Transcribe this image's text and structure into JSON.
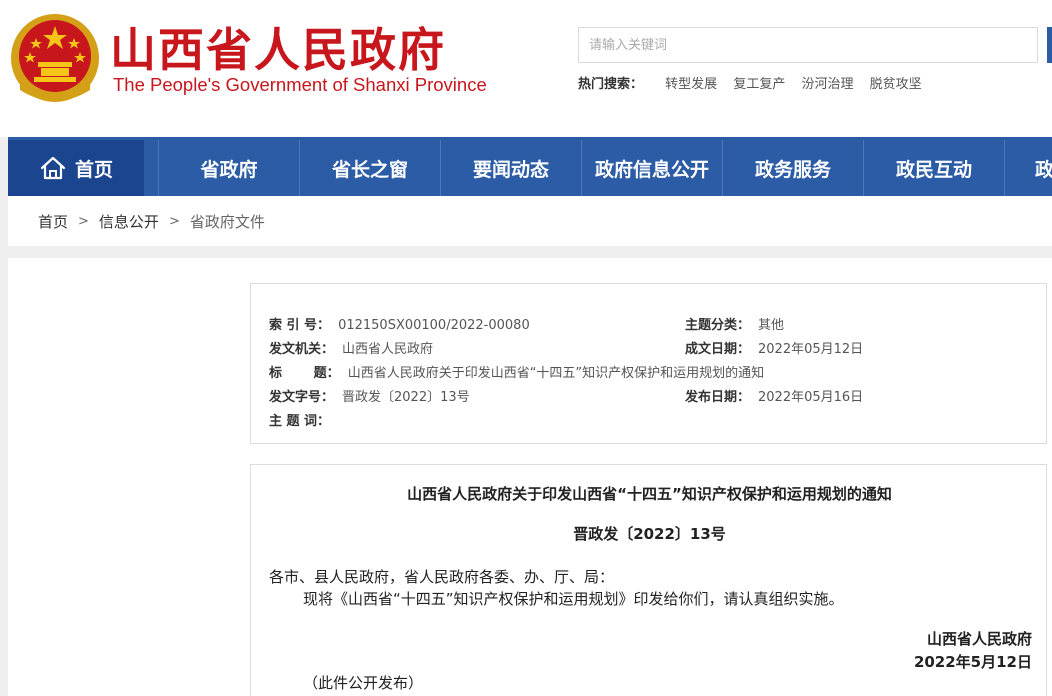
{
  "header": {
    "title": "山西省人民政府",
    "subtitle": "The People's Government of Shanxi Province",
    "search_placeholder": "请输入关键词",
    "hot_label": "热门搜索：",
    "hot_links": [
      "转型发展",
      "复工复产",
      "汾河治理",
      "脱贫攻坚"
    ]
  },
  "colors": {
    "brand_red": "#c8161d",
    "nav_blue": "#2b5ca5",
    "nav_active": "#1c4590"
  },
  "nav": {
    "home": "首页",
    "items": [
      "省政府",
      "省长之窗",
      "要闻动态",
      "政府信息公开",
      "政务服务",
      "政民互动",
      "政"
    ]
  },
  "breadcrumb": {
    "items": [
      "首页",
      "信息公开"
    ],
    "separator": ">",
    "current": "省政府文件"
  },
  "meta": {
    "index_key": "索  引 号：",
    "index_val": "012150SX00100/2022-00080",
    "category_key": "主题分类：",
    "category_val": "其他",
    "issuer_key": "发文机关：",
    "issuer_val": "山西省人民政府",
    "date_written_key": "成文日期：",
    "date_written_val": "2022年05月12日",
    "title_key": "标       题：",
    "title_val": "山西省人民政府关于印发山西省“十四五”知识产权保护和运用规划的通知",
    "doc_no_key": "发文字号：",
    "doc_no_val": "晋政发〔2022〕13号",
    "publish_key": "发布日期：",
    "publish_val": "2022年05月16日",
    "keywords_key": "主 题 词：",
    "keywords_val": ""
  },
  "document": {
    "title": "山西省人民政府关于印发山西省“十四五”知识产权保护和运用规划的通知",
    "number": "晋政发〔2022〕13号",
    "salutation": "各市、县人民政府，省人民政府各委、办、厅、局：",
    "body": "现将《山西省“十四五”知识产权保护和运用规划》印发给你们，请认真组织实施。",
    "sign_org": "山西省人民政府",
    "sign_date": "2022年5月12日",
    "note": "（此件公开发布）"
  }
}
